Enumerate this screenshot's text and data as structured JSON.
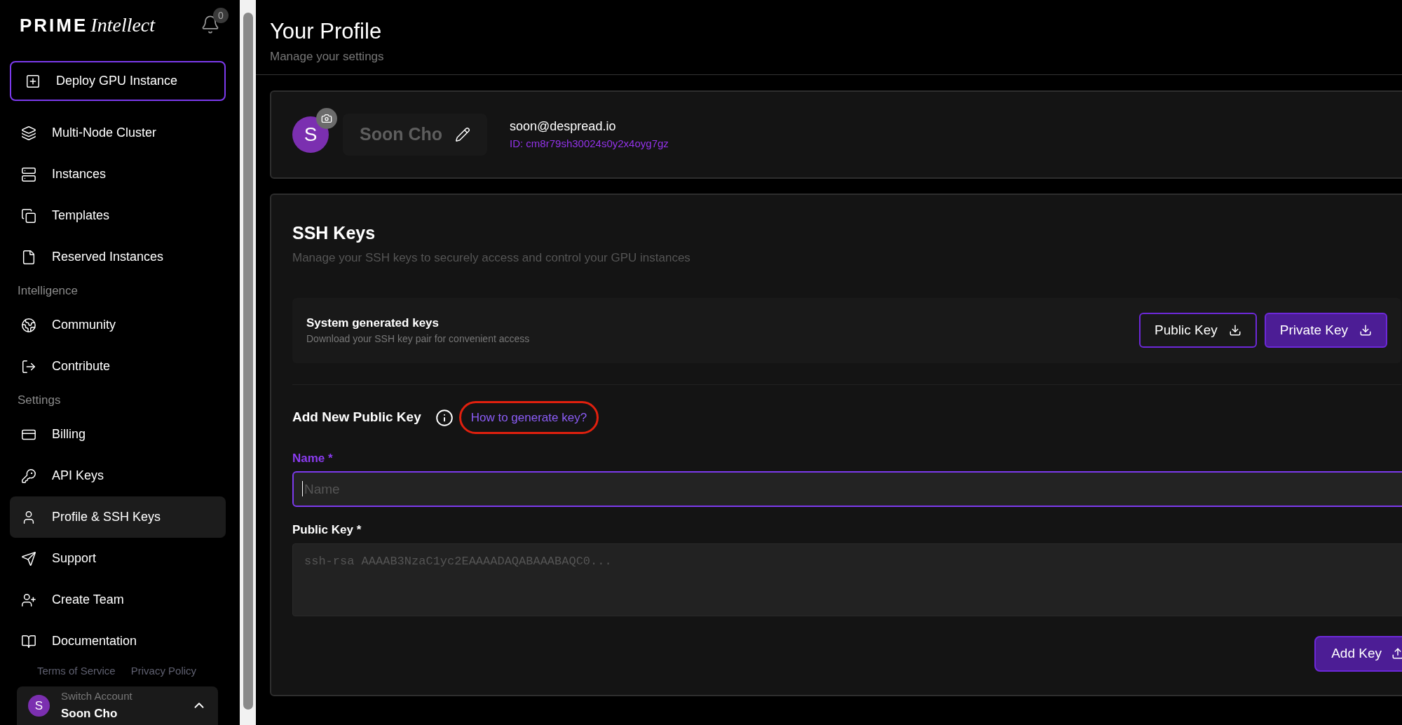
{
  "logo": {
    "word1": "PRIME",
    "word2": "Intellect"
  },
  "notifications": {
    "count": "0"
  },
  "sidebar": {
    "deploy_button": "Deploy GPU Instance",
    "items": [
      {
        "kind": "item",
        "label": "Multi-Node Cluster",
        "selected": false
      },
      {
        "kind": "item",
        "label": "Instances",
        "selected": false
      },
      {
        "kind": "item",
        "label": "Templates",
        "selected": false
      },
      {
        "kind": "item",
        "label": "Reserved Instances",
        "selected": false
      },
      {
        "kind": "heading",
        "label": "Intelligence"
      },
      {
        "kind": "item",
        "label": "Community",
        "selected": false
      },
      {
        "kind": "item",
        "label": "Contribute",
        "selected": false
      },
      {
        "kind": "heading",
        "label": "Settings"
      },
      {
        "kind": "item",
        "label": "Billing",
        "selected": false
      },
      {
        "kind": "item",
        "label": "API Keys",
        "selected": false
      },
      {
        "kind": "item",
        "label": "Profile & SSH Keys",
        "selected": true
      },
      {
        "kind": "item",
        "label": "Support",
        "selected": false
      },
      {
        "kind": "item",
        "label": "Create Team",
        "selected": false
      },
      {
        "kind": "item",
        "label": "Documentation",
        "selected": false
      }
    ],
    "footer_links": [
      "Terms of Service",
      "Privacy Policy"
    ],
    "account": {
      "initial": "S",
      "caption": "Switch Account",
      "name": "Soon Cho"
    }
  },
  "page": {
    "title": "Your Profile",
    "subtitle": "Manage your settings"
  },
  "profile": {
    "initial": "S",
    "name": "Soon Cho",
    "email": "soon@despread.io",
    "id": "ID: cm8r79sh30024s0y2x4oyg7gz"
  },
  "ssh": {
    "title": "SSH Keys",
    "description": "Manage your SSH keys to securely access and control your GPU instances",
    "system_keys": {
      "title": "System generated keys",
      "description": "Download your SSH key pair for convenient access",
      "buttons": [
        {
          "kind": "outline",
          "label": "Public Key"
        },
        {
          "kind": "filled",
          "label": "Private Key"
        }
      ]
    },
    "add": {
      "title": "Add New Public Key",
      "help_link": {
        "label": "How to generate key?",
        "circled": true
      },
      "fields": [
        {
          "kind": "input",
          "label": "Name *",
          "placeholder": "Name",
          "focused": true
        },
        {
          "kind": "textarea",
          "label": "Public Key *",
          "placeholder": "ssh-rsa AAAAB3NzaC1yc2EAAAADAQABAAABAQC0...",
          "focused": false
        }
      ],
      "submit": "Add Key"
    }
  }
}
